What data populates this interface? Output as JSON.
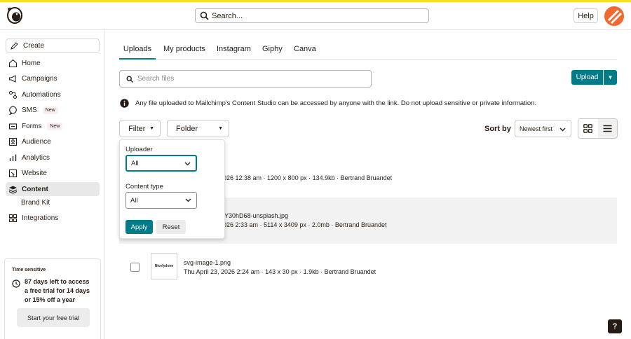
{
  "header": {
    "search_placeholder": "Search...",
    "help_label": "Help",
    "accent_color": "#ffe01b",
    "avatar_color": "#f26a2e"
  },
  "sidebar": {
    "create_label": "Create",
    "items": [
      {
        "label": "Home",
        "icon": "home-icon"
      },
      {
        "label": "Campaigns",
        "icon": "megaphone-icon"
      },
      {
        "label": "Automations",
        "icon": "automations-icon"
      },
      {
        "label": "SMS",
        "icon": "sms-icon",
        "badge": "New"
      },
      {
        "label": "Forms",
        "icon": "forms-icon",
        "badge": "New"
      },
      {
        "label": "Audience",
        "icon": "audience-icon"
      },
      {
        "label": "Analytics",
        "icon": "analytics-icon"
      },
      {
        "label": "Website",
        "icon": "website-icon"
      },
      {
        "label": "Content",
        "icon": "content-icon",
        "active": true
      },
      {
        "label": "Integrations",
        "icon": "integrations-icon"
      }
    ],
    "sub_item": "Brand Kit",
    "trial": {
      "title": "Time sensitive",
      "message": "87 days left to access a free trial for 14 days or 15% off a year",
      "button": "Start your free trial"
    }
  },
  "main": {
    "tabs": [
      "Uploads",
      "My products",
      "Instagram",
      "Giphy",
      "Canva"
    ],
    "active_tab": "Uploads",
    "file_search_placeholder": "Search files",
    "upload_label": "Upload",
    "info_text": "Any file uploaded to Mailchimp's Content Studio can be accessed by anyone with the link. Do not upload sensitive or private information.",
    "filter_label": "Filter",
    "folder_label": "Folder",
    "sort_by_label": "Sort by",
    "sort_value": "Newest first",
    "accent_color": "#007c89"
  },
  "filter_popover": {
    "uploader_label": "Uploader",
    "uploader_value": "All",
    "content_type_label": "Content type",
    "content_type_value": "All",
    "apply_label": "Apply",
    "reset_label": "Reset"
  },
  "files": [
    {
      "name": "",
      "meta": "026 12:38 am · 1200 x 800 px · 134.9kb · Bertrand Bruandet"
    },
    {
      "name": "Y30hD68-unsplash.jpg",
      "meta": "026 2:33 am · 5114 x 3409 px · 2.0mb · Bertrand Bruandet"
    },
    {
      "name": "svg-image-1.png",
      "meta": "Thu April 23, 2026 2:24 am · 143 x 30 px · 1.9kb · Bertrand Bruandet",
      "thumb_text": "Nicelydone"
    }
  ],
  "fab_help": "?"
}
